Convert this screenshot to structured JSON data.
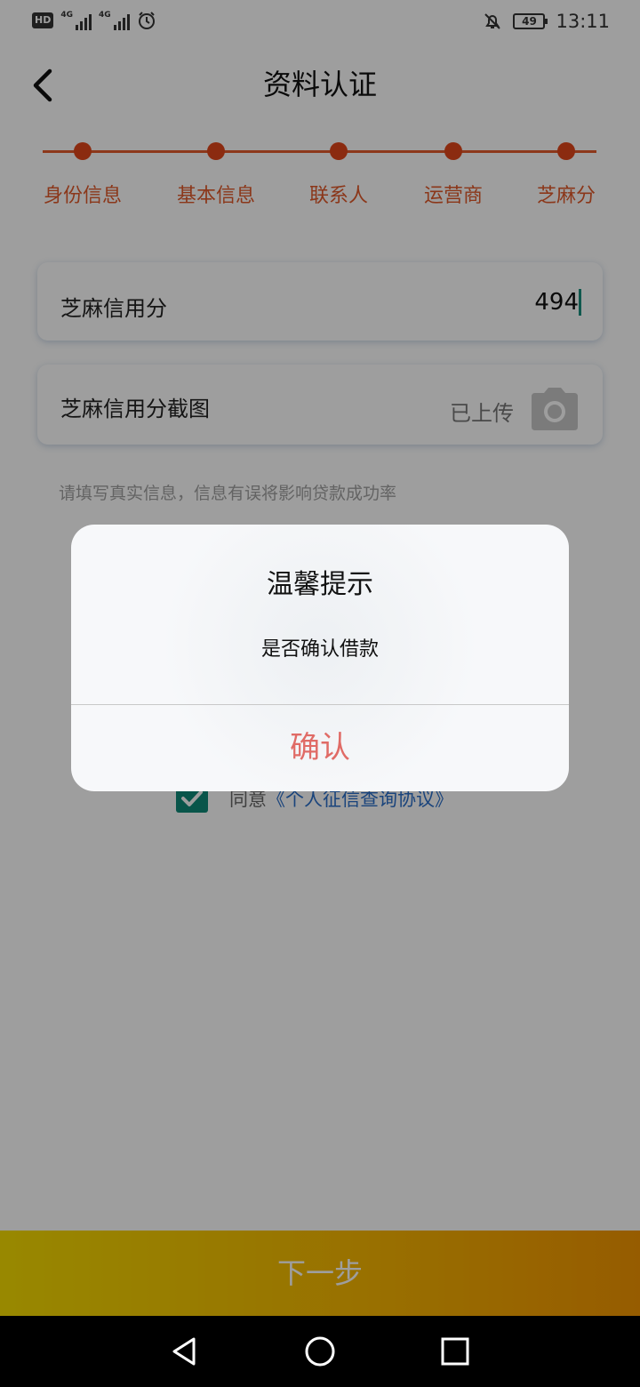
{
  "status_bar": {
    "hd": "HD",
    "sig1": "4G",
    "sig2": "4G",
    "battery": "49",
    "time": "13:11"
  },
  "header": {
    "title": "资料认证"
  },
  "steps": [
    "身份信息",
    "基本信息",
    "联系人",
    "运营商",
    "芝麻分"
  ],
  "form": {
    "score_label": "芝麻信用分",
    "score_value": "494",
    "screenshot_label": "芝麻信用分截图",
    "screenshot_status": "已上传",
    "hint": "请填写真实信息，信息有误将影响贷款成功率"
  },
  "agreement": {
    "prefix": "同意",
    "link": "《个人征信查询协议》"
  },
  "next_button": "下一步",
  "dialog": {
    "title": "温馨提示",
    "message": "是否确认借款",
    "confirm": "确认"
  },
  "colors": {
    "accent": "#e0461a",
    "check": "#0f8a78",
    "link": "#2a6fc9",
    "confirm": "#e06b66"
  },
  "icons": [
    "back-arrow-icon",
    "camera-icon",
    "checkmark-icon",
    "nav-back-icon",
    "nav-home-icon",
    "nav-recents-icon",
    "alarm-icon",
    "mute-bell-icon"
  ]
}
